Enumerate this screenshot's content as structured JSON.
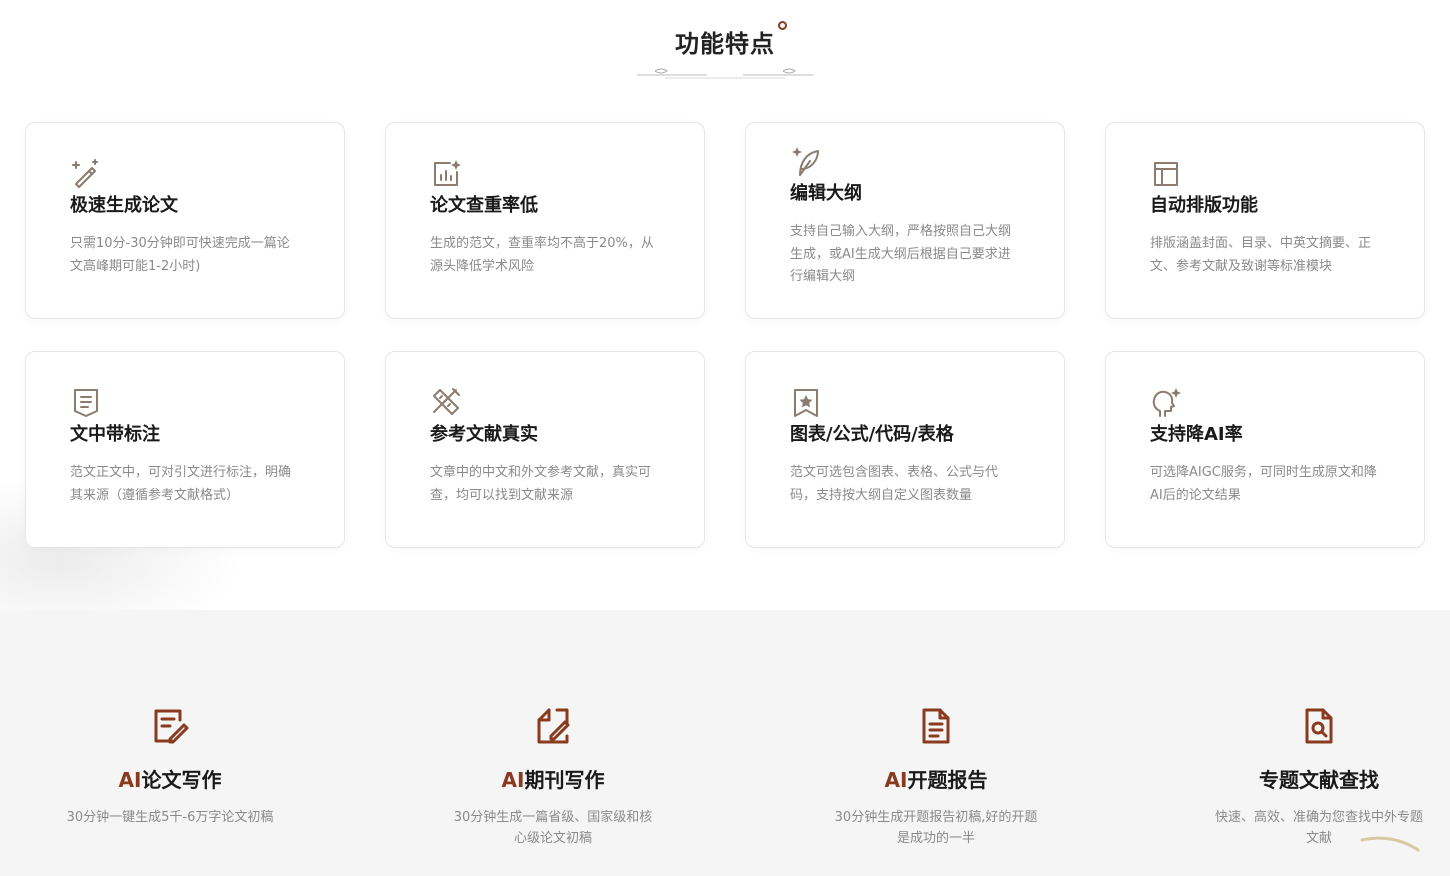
{
  "section": {
    "title": "功能特点"
  },
  "features": [
    {
      "icon": "magic-wand-icon",
      "title": "极速生成论文",
      "desc": "只需10分-30分钟即可快速完成一篇论文高峰期可能1-2小时)"
    },
    {
      "icon": "chart-sparkle-icon",
      "title": "论文查重率低",
      "desc": "生成的范文，查重率均不高于20%，从源头降低学术风险"
    },
    {
      "icon": "feather-icon",
      "title": "编辑大纲",
      "desc": "支持自己输入大纲，严格按照自己大纲生成，或AI生成大纲后根据自己要求进行编辑大纲"
    },
    {
      "icon": "layout-icon",
      "title": "自动排版功能",
      "desc": "排版涵盖封面、目录、中英文摘要、正文、参考文献及致谢等标准模块"
    },
    {
      "icon": "ribbon-note-icon",
      "title": "文中带标注",
      "desc": "范文正文中，可对引文进行标注，明确其来源（遵循参考文献格式）"
    },
    {
      "icon": "ruler-pencil-icon",
      "title": "参考文献真实",
      "desc": "文章中的中文和外文参考文献，真实可查，均可以找到文献来源"
    },
    {
      "icon": "star-frame-icon",
      "title": "图表/公式/代码/表格",
      "desc": "范文可选包含图表、表格、公式与代码，支持按大纲自定义图表数量"
    },
    {
      "icon": "ai-head-icon",
      "title": "支持降AI率",
      "desc": "可选降AIGC服务，可同时生成原文和降AI后的论文结果"
    }
  ],
  "services": [
    {
      "icon": "edit-document-icon",
      "title_prefix": "AI",
      "title_rest": "论文写作",
      "desc": "30分钟一键生成5千-6万字论文初稿"
    },
    {
      "icon": "journal-edit-icon",
      "title_prefix": "AI",
      "title_rest": "期刊写作",
      "desc": "30分钟生成一篇省级、国家级和核心级论文初稿"
    },
    {
      "icon": "report-document-icon",
      "title_prefix": "AI",
      "title_rest": "开题报告",
      "desc": "30分钟生成开题报告初稿,好的开题是成功的一半"
    },
    {
      "icon": "search-document-icon",
      "title_prefix": "",
      "title_rest": "专题文献查找",
      "desc": "快速、高效、准确为您查找中外专题文献"
    }
  ],
  "colors": {
    "accent": "#8a3a1f",
    "icon_gray": "#8c7b6e",
    "text_muted": "#8a8a8a"
  }
}
